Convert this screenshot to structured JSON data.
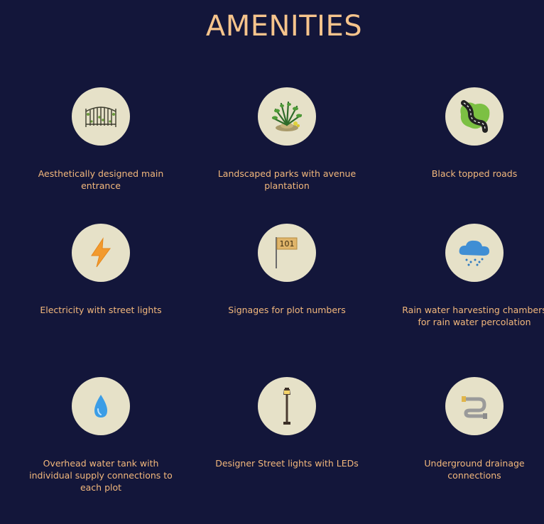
{
  "page": {
    "title": "AMENITIES"
  },
  "amenities": [
    {
      "label": "Aesthetically designed main entrance",
      "icon": "gate-icon"
    },
    {
      "label": "Landscaped parks with avenue plantation",
      "icon": "park-icon"
    },
    {
      "label": "Black topped roads",
      "icon": "road-icon"
    },
    {
      "label": "Electricity with street lights",
      "icon": "lightning-icon"
    },
    {
      "label": "Signages for plot numbers",
      "icon": "signage-icon",
      "sign_text": "101"
    },
    {
      "label": "Rain water harvesting chambers for rain water percolation",
      "icon": "rain-cloud-icon"
    },
    {
      "label": "Overhead water tank with individual supply connections to each plot",
      "icon": "water-drop-icon"
    },
    {
      "label": "Designer Street lights with LEDs",
      "icon": "street-lamp-icon"
    },
    {
      "label": "Underground drainage connections",
      "icon": "pipe-icon"
    }
  ],
  "colors": {
    "background": "#13163a",
    "title": "#f6c48c",
    "label": "#f3b87c",
    "circle": "#e6e1c8"
  }
}
